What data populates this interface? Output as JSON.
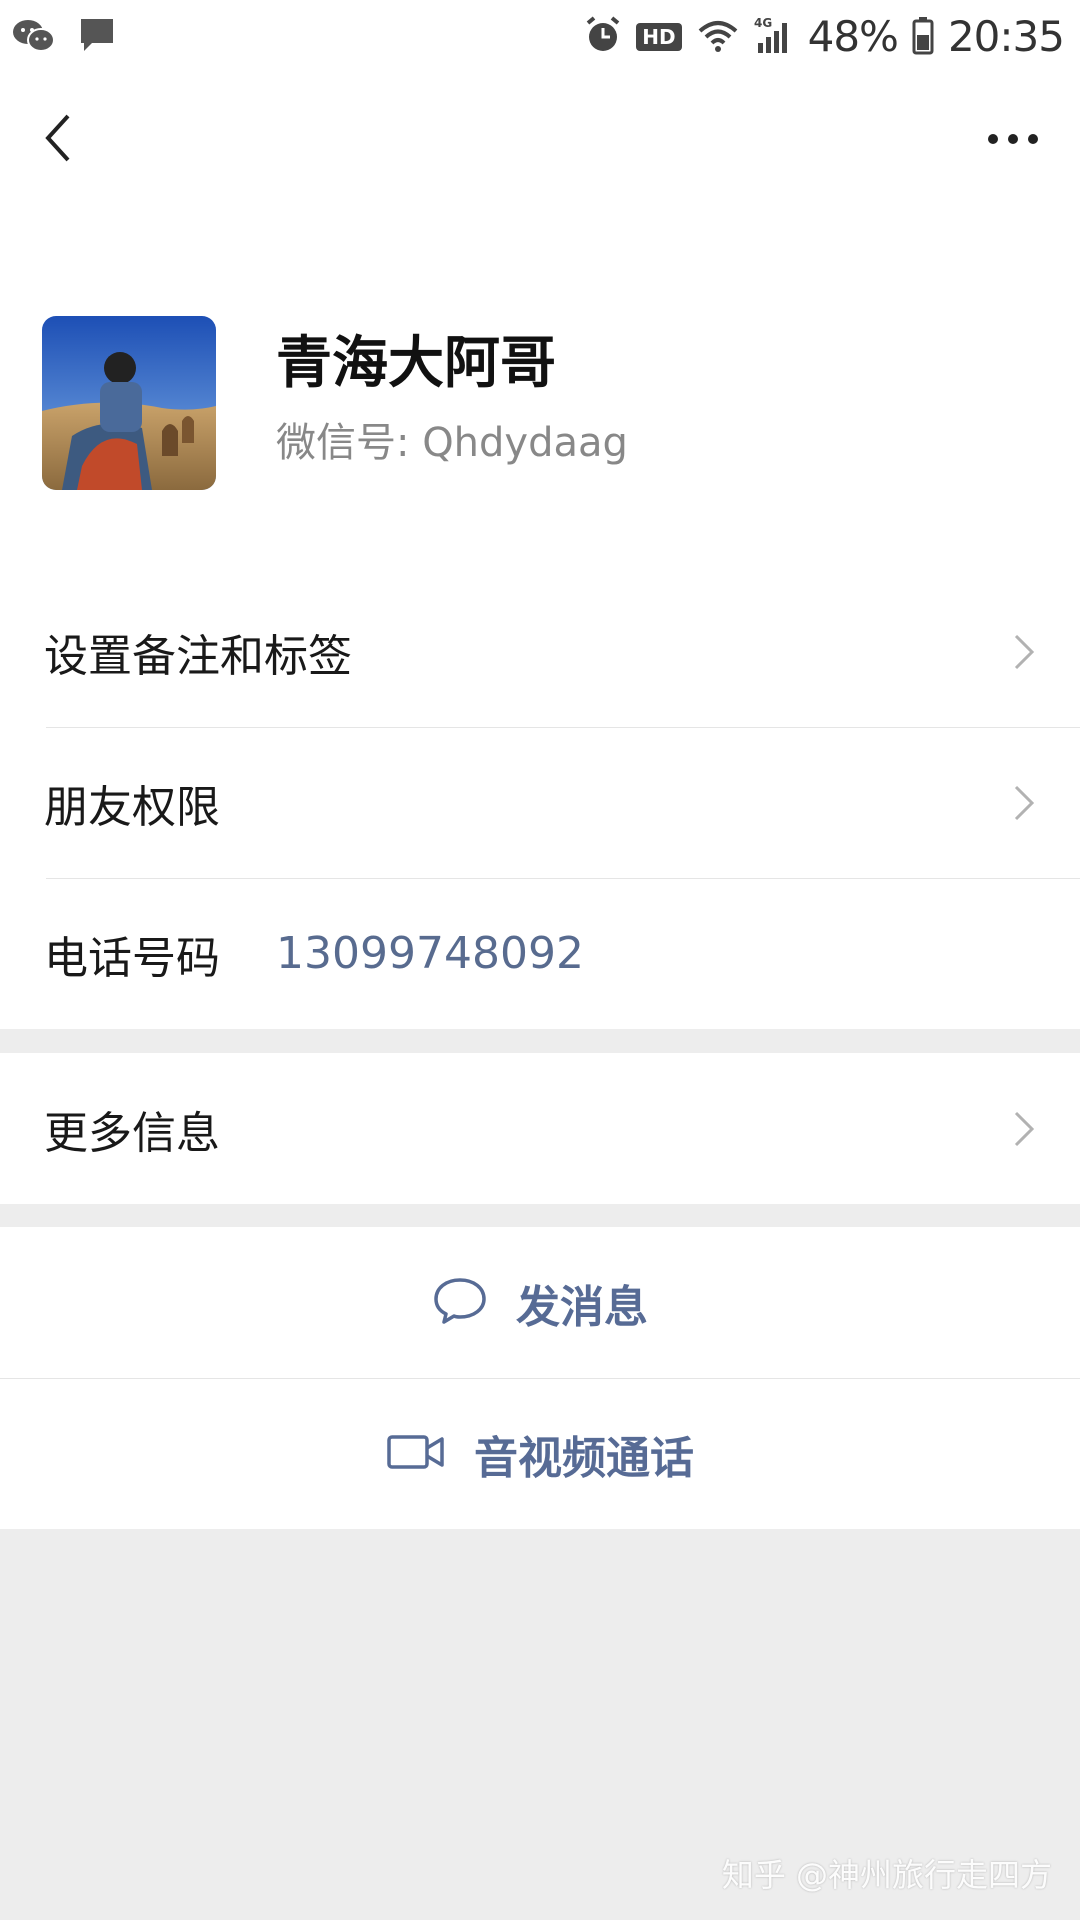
{
  "status_bar": {
    "battery_percent": "48%",
    "time": "20:35",
    "network": "4G",
    "hd": "HD"
  },
  "header": {
    "name": "青海大阿哥",
    "wechat_id": "微信号: Qhdydaag"
  },
  "rows": {
    "remark_tags": "设置备注和标签",
    "friend_permissions": "朋友权限",
    "phone_label": "电话号码",
    "phone_value": "13099748092",
    "more_info": "更多信息"
  },
  "actions": {
    "send_message": "发消息",
    "video_call": "音视频通话"
  },
  "watermark": "知乎 @神州旅行走四方",
  "colors": {
    "link": "#576b95",
    "background": "#ededed"
  }
}
